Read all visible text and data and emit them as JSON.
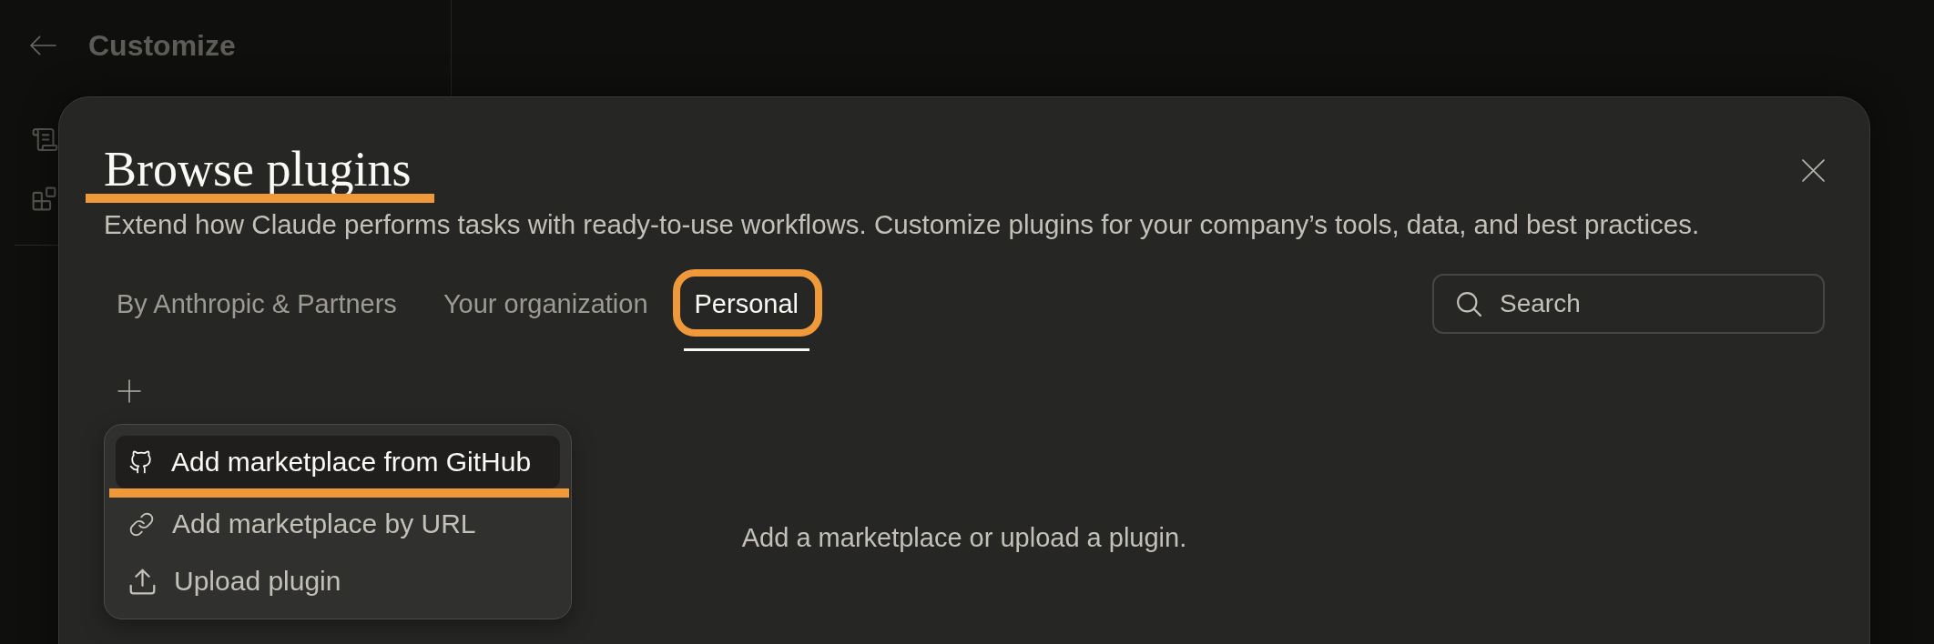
{
  "sidebar": {
    "title": "Customize"
  },
  "dialog": {
    "title": {
      "text": "Browse plugins",
      "annotated": true
    },
    "description": "Extend how Claude performs tasks with ready-to-use workflows. Customize plugins for your company’s tools, data, and best practices.",
    "tabs": [
      {
        "label": "By Anthropic & Partners",
        "selected": false,
        "annotated": false
      },
      {
        "label": "Your organization",
        "selected": false,
        "annotated": false
      },
      {
        "label": "Personal",
        "selected": true,
        "annotated": true
      }
    ],
    "search": {
      "placeholder": "Search"
    },
    "add_menu": {
      "open": true,
      "items": [
        {
          "kind": "github",
          "label": "Add marketplace from GitHub",
          "highlighted": true,
          "annotated": true
        },
        {
          "kind": "link",
          "label": "Add marketplace by URL",
          "highlighted": false,
          "annotated": false
        },
        {
          "kind": "upload",
          "label": "Upload plugin",
          "highlighted": false,
          "annotated": false
        }
      ]
    },
    "empty_state": "Add a marketplace or upload a plugin."
  }
}
